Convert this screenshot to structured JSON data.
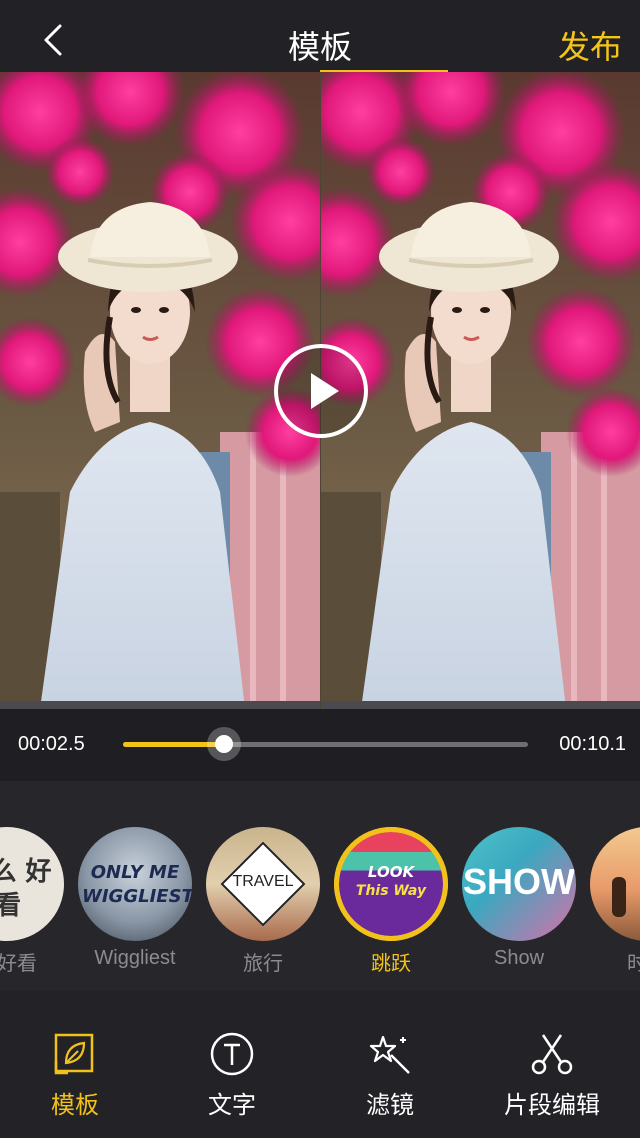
{
  "header": {
    "title": "模板",
    "publish_label": "发布"
  },
  "player": {
    "current_time": "00:02.5",
    "total_time": "00:10.1",
    "progress": 0.25
  },
  "templates": [
    {
      "label": "么好看",
      "overlay_text": "怎么 好看"
    },
    {
      "label": "Wiggliest",
      "overlay_text": "ONLY ME WIGGLIEST"
    },
    {
      "label": "旅行",
      "overlay_text": "TRAVEL"
    },
    {
      "label": "跳跃",
      "overlay_text_1": "LOOK",
      "overlay_text_2": "This Way",
      "selected": true
    },
    {
      "label": "Show",
      "overlay_text": "SHOW"
    },
    {
      "label": "时光"
    }
  ],
  "bottom_nav": [
    {
      "label": "模板",
      "icon": "template-leaf-icon",
      "active": true
    },
    {
      "label": "文字",
      "icon": "text-icon"
    },
    {
      "label": "滤镜",
      "icon": "magic-wand-icon"
    },
    {
      "label": "片段编辑",
      "icon": "scissors-icon"
    }
  ],
  "colors": {
    "accent": "#f2c21b",
    "background": "#232327",
    "muted": "#8c8c90"
  }
}
